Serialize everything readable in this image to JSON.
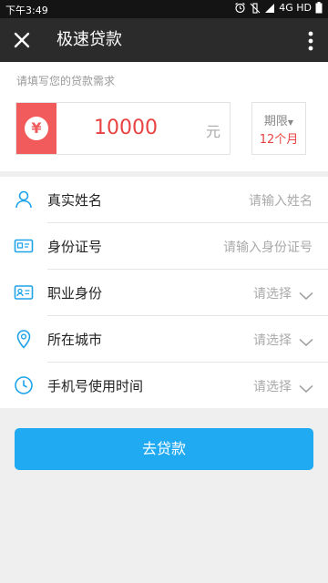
{
  "statusbar": {
    "time": "下午3:49",
    "network": "4G HD",
    "icons": [
      "alarm-icon",
      "mute-icon",
      "signal-icon",
      "battery-icon"
    ]
  },
  "titlebar": {
    "title": "极速贷款",
    "icons": [
      "close-icon",
      "more-vert-icon"
    ]
  },
  "loan": {
    "hint": "请填写您的贷款需求",
    "currency_symbol": "¥",
    "amount": "10000",
    "unit": "元",
    "term_label": "期限",
    "term_value": "12个月"
  },
  "fields": [
    {
      "label": "真实姓名",
      "placeholder": "请输入姓名",
      "icon": "person-icon"
    },
    {
      "label": "身份证号",
      "placeholder": "请输入身份证号",
      "icon": "id-card-icon"
    },
    {
      "label": "职业身份",
      "placeholder": "请选择",
      "icon": "badge-icon"
    },
    {
      "label": "所在城市",
      "placeholder": "请选择",
      "icon": "location-pin-icon"
    },
    {
      "label": "手机号使用时间",
      "placeholder": "请选择",
      "icon": "clock-icon"
    }
  ],
  "submit_label": "去贷款",
  "colors": {
    "accent_red": "#f25b5b",
    "accent_blue": "#20aaf2",
    "icon_blue": "#1ea3e8",
    "header": "#2b2b2b"
  }
}
